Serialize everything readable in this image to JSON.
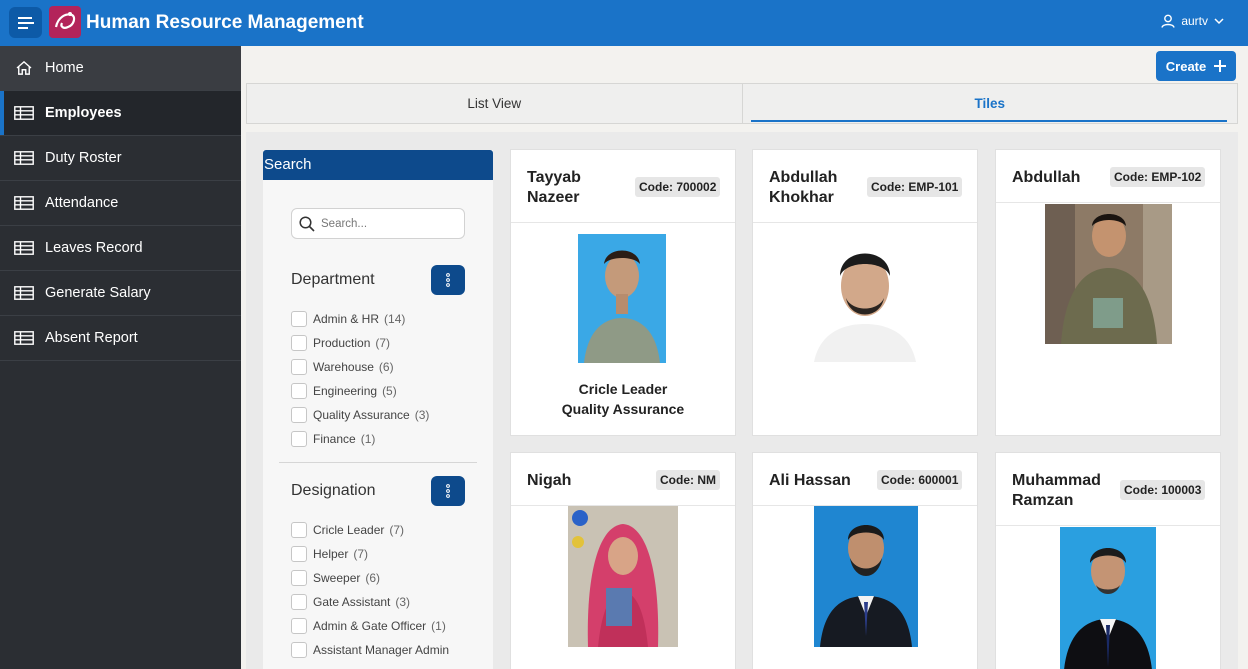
{
  "header": {
    "app_title": "Human Resource Management",
    "user": "aurtv"
  },
  "sidebar": {
    "items": [
      {
        "label": "Home",
        "icon": "home-icon"
      },
      {
        "label": "Employees",
        "icon": "table-icon",
        "active": true
      },
      {
        "label": "Duty Roster",
        "icon": "table-icon"
      },
      {
        "label": "Attendance",
        "icon": "table-icon"
      },
      {
        "label": "Leaves Record",
        "icon": "table-icon"
      },
      {
        "label": "Generate Salary",
        "icon": "table-icon"
      },
      {
        "label": "Absent Report",
        "icon": "table-icon"
      }
    ]
  },
  "toolbar": {
    "create_label": "Create"
  },
  "tabs": [
    {
      "label": "List View"
    },
    {
      "label": "Tiles",
      "active": true
    }
  ],
  "search": {
    "title": "Search",
    "placeholder": "Search..."
  },
  "facets": {
    "department": {
      "title": "Department",
      "options": [
        {
          "label": "Admin & HR",
          "count": "(14)"
        },
        {
          "label": "Production",
          "count": "(7)"
        },
        {
          "label": "Warehouse",
          "count": "(6)"
        },
        {
          "label": "Engineering",
          "count": "(5)"
        },
        {
          "label": "Quality Assurance",
          "count": "(3)"
        },
        {
          "label": "Finance",
          "count": "(1)"
        }
      ]
    },
    "designation": {
      "title": "Designation",
      "options": [
        {
          "label": "Cricle Leader",
          "count": "(7)"
        },
        {
          "label": "Helper",
          "count": "(7)"
        },
        {
          "label": "Sweeper",
          "count": "(6)"
        },
        {
          "label": "Gate Assistant",
          "count": "(3)"
        },
        {
          "label": "Admin & Gate Officer",
          "count": "(1)"
        },
        {
          "label": "Assistant Manager Admin",
          "count": ""
        }
      ]
    }
  },
  "cards": [
    {
      "name_line1": "Tayyab",
      "name_line2": "Nazeer",
      "code": "Code: 700002",
      "designation": "Cricle Leader",
      "department": "Quality Assurance"
    },
    {
      "name_line1": "Abdullah",
      "name_line2": "Khokhar",
      "code": "Code: EMP-101"
    },
    {
      "name_line1": "Abdullah",
      "name_line2": "",
      "code": "Code: EMP-102"
    },
    {
      "name_line1": "Nigah",
      "name_line2": "",
      "code": "Code: NM"
    },
    {
      "name_line1": "Ali Hassan",
      "name_line2": "",
      "code": "Code: 600001"
    },
    {
      "name_line1": "Muhammad",
      "name_line2": "Ramzan",
      "code": "Code: 100003"
    }
  ],
  "colors": {
    "header_bg": "#1a73c8",
    "sidebar_bg": "#2b2e33",
    "accent": "#1a73c8",
    "facet_header_bg": "#0d4a8c"
  }
}
